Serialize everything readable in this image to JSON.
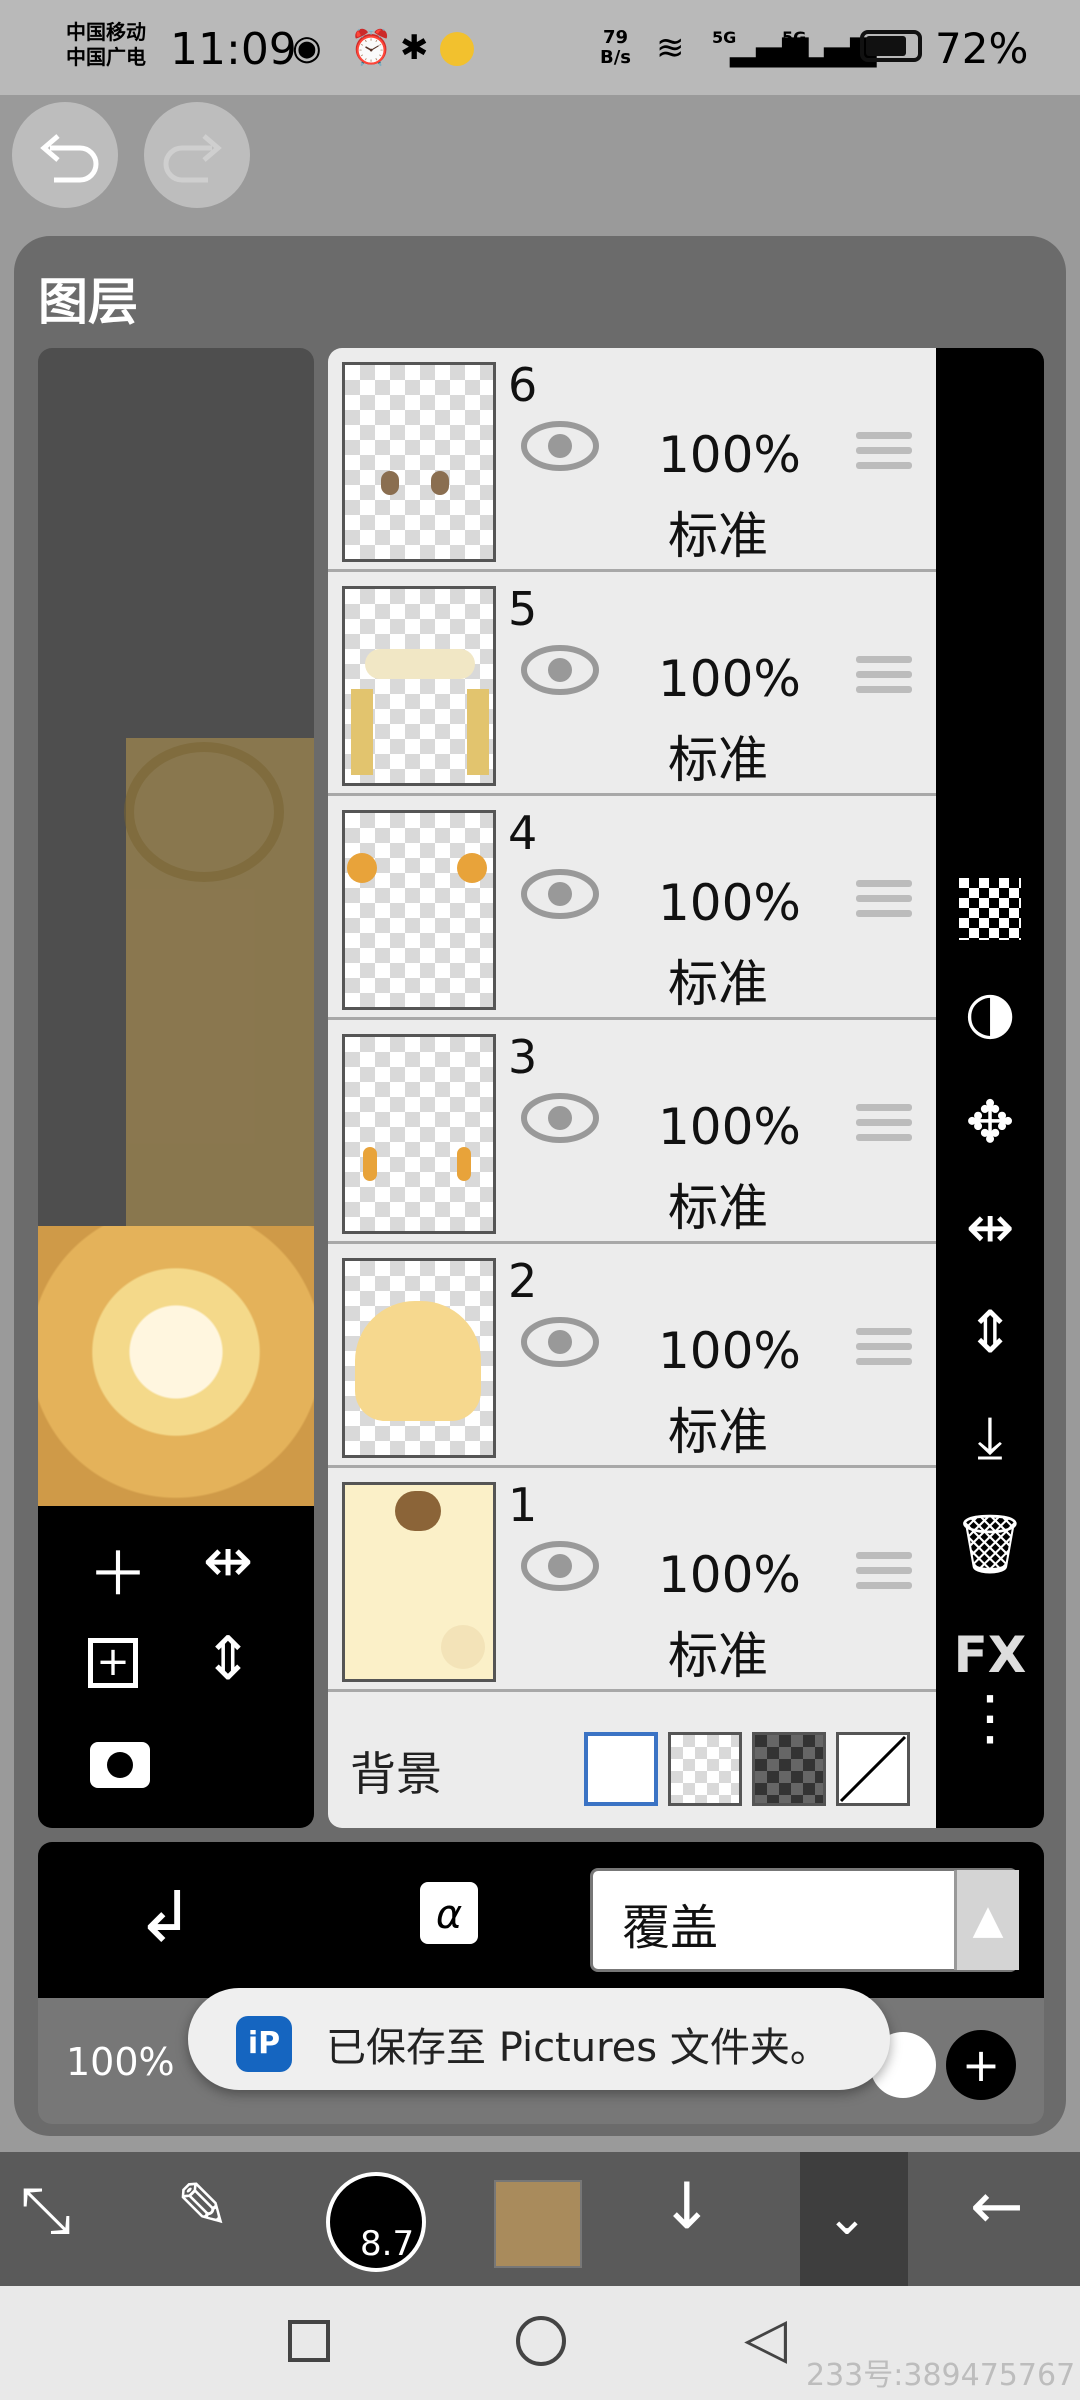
{
  "status_bar": {
    "carrier1": "中国移动",
    "carrier2": "中国广电",
    "time": "11:09",
    "net_speed_value": "79",
    "net_speed_unit": "B/s",
    "signal1_label": "5G",
    "signal2_label": "5G",
    "battery": "72%"
  },
  "panel": {
    "title": "图层"
  },
  "layers": [
    {
      "number": "6",
      "opacity": "100%",
      "mode": "标准"
    },
    {
      "number": "5",
      "opacity": "100%",
      "mode": "标准"
    },
    {
      "number": "4",
      "opacity": "100%",
      "mode": "标准"
    },
    {
      "number": "3",
      "opacity": "100%",
      "mode": "标准"
    },
    {
      "number": "2",
      "opacity": "100%",
      "mode": "标准"
    },
    {
      "number": "1",
      "opacity": "100%",
      "mode": "标准"
    }
  ],
  "background": {
    "label": "背景",
    "options": [
      "white",
      "transparent",
      "dark-checker",
      "none"
    ]
  },
  "side_tools": {
    "fx_label": "FX"
  },
  "blend": {
    "mode": "覆盖"
  },
  "opacity": {
    "value": "100%"
  },
  "toast": {
    "icon_text": "iP",
    "message": "已保存至 Pictures 文件夹。"
  },
  "toolbar": {
    "brush_size": "8.7",
    "current_color": "#a98b5c"
  },
  "watermark": "233号:389475767",
  "colors": {
    "panel": "#6b6b6b",
    "toast_icon": "#1565c0"
  }
}
